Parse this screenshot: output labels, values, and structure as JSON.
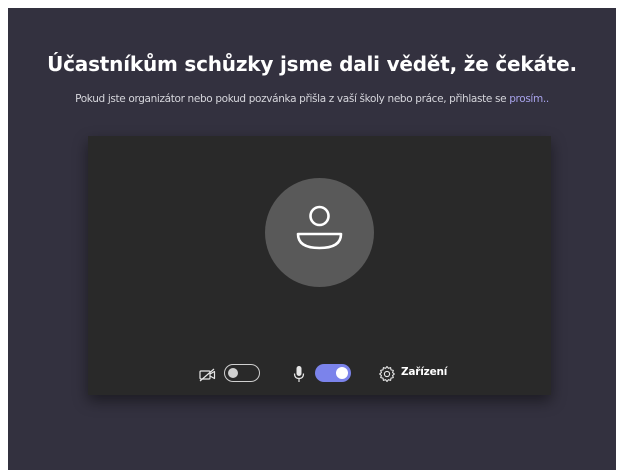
{
  "lobby": {
    "title": "Účastníkům schůzky jsme dali vědět, že čekáte.",
    "subtitle_text": "Pokud jste organizátor nebo pokud pozvánka přišla z vaší školy nebo práce, přihlaste se ",
    "subtitle_link": "prosím..",
    "colors": {
      "background": "#33313f",
      "preview": "#292929",
      "avatar": "#595959",
      "accent": "#7b83eb",
      "link": "#a7a2ea"
    }
  },
  "controls": {
    "camera": {
      "icon": "camera-off-icon",
      "state": "off"
    },
    "microphone": {
      "icon": "microphone-icon",
      "state": "on"
    },
    "devices": {
      "icon": "gear-icon",
      "label": "Zařízení"
    }
  }
}
